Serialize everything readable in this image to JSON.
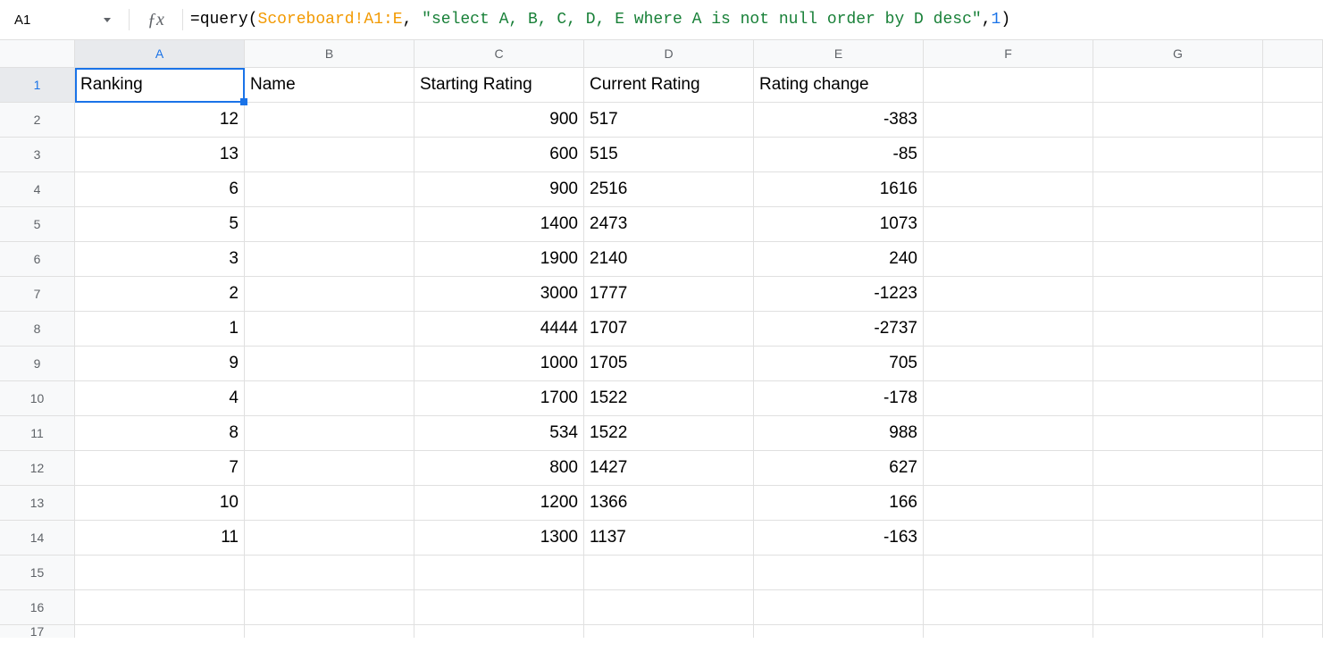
{
  "formula_bar": {
    "cell_ref": "A1",
    "fx_label": "ƒx",
    "formula_prefix": "=",
    "formula_fn": "query",
    "formula_lparen": "(",
    "formula_range": "Scoreboard!A1:E",
    "formula_comma1": ", ",
    "formula_str": "\"select A, B, C, D, E where A is not null order by D desc\"",
    "formula_comma2": ",",
    "formula_num": "1",
    "formula_rparen": ")"
  },
  "columns": [
    "A",
    "B",
    "C",
    "D",
    "E",
    "F",
    "G"
  ],
  "selected_cell": "A1",
  "headers": {
    "A": "Ranking",
    "B": "Name",
    "C": "Starting Rating",
    "D": "Current Rating",
    "E": "Rating change"
  },
  "rows": [
    {
      "n": 1
    },
    {
      "n": 2,
      "A": "12",
      "C": "900",
      "D": "517",
      "E": "-383"
    },
    {
      "n": 3,
      "A": "13",
      "C": "600",
      "D": "515",
      "E": "-85"
    },
    {
      "n": 4,
      "A": "6",
      "C": "900",
      "D": "2516",
      "E": "1616"
    },
    {
      "n": 5,
      "A": "5",
      "C": "1400",
      "D": "2473",
      "E": "1073"
    },
    {
      "n": 6,
      "A": "3",
      "C": "1900",
      "D": "2140",
      "E": "240"
    },
    {
      "n": 7,
      "A": "2",
      "C": "3000",
      "D": "1777",
      "E": "-1223"
    },
    {
      "n": 8,
      "A": "1",
      "C": "4444",
      "D": "1707",
      "E": "-2737"
    },
    {
      "n": 9,
      "A": "9",
      "C": "1000",
      "D": "1705",
      "E": "705"
    },
    {
      "n": 10,
      "A": "4",
      "C": "1700",
      "D": "1522",
      "E": "-178"
    },
    {
      "n": 11,
      "A": "8",
      "C": "534",
      "D": "1522",
      "E": "988"
    },
    {
      "n": 12,
      "A": "7",
      "C": "800",
      "D": "1427",
      "E": "627"
    },
    {
      "n": 13,
      "A": "10",
      "C": "1200",
      "D": "1366",
      "E": "166"
    },
    {
      "n": 14,
      "A": "11",
      "C": "1300",
      "D": "1137",
      "E": "-163"
    },
    {
      "n": 15
    },
    {
      "n": 16
    },
    {
      "n": 17
    }
  ]
}
